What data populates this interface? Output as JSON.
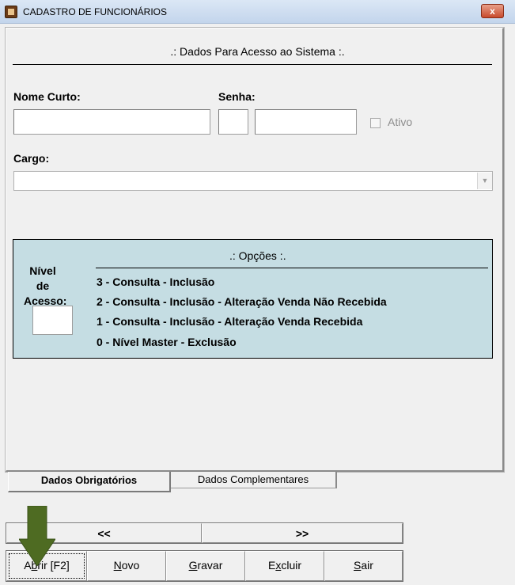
{
  "window": {
    "title": "CADASTRO DE FUNCIONÁRIOS",
    "close_label": "x"
  },
  "section_title": ".: Dados Para Acesso ao Sistema :.",
  "fields": {
    "nome_curto_label": "Nome Curto:",
    "nome_curto_value": "",
    "senha_label": "Senha:",
    "senha_prefix_value": "",
    "senha_value": "",
    "ativo_label": "Ativo",
    "cargo_label": "Cargo:",
    "cargo_value": ""
  },
  "options": {
    "title": ".: Opções :.",
    "nivel_label_line1": "Nível de",
    "nivel_label_line2": "Acesso:",
    "nivel_value": "",
    "items": [
      "3 - Consulta - Inclusão",
      "2 - Consulta - Inclusão - Alteração Venda Não Recebida",
      "1 - Consulta - Inclusão - Alteração Venda Recebida",
      "0 - Nível Master - Exclusão"
    ]
  },
  "tabs": [
    {
      "label": "Dados Obrigatórios",
      "active": true
    },
    {
      "label": "Dados Complementares",
      "active": false
    }
  ],
  "nav": {
    "prev": "<<",
    "next": ">>"
  },
  "buttons": {
    "abrir_pre": "A",
    "abrir_ul": "b",
    "abrir_post": "rir [F2]",
    "novo_ul": "N",
    "novo_post": "ovo",
    "gravar_ul": "G",
    "gravar_post": "ravar",
    "excluir_pre": "E",
    "excluir_ul": "x",
    "excluir_post": "cluir",
    "sair_ul": "S",
    "sair_post": "air"
  },
  "icons": {
    "window_icon": "app-icon",
    "pointer": "down-arrow-icon",
    "dropdown": "chevron-down-icon"
  },
  "colors": {
    "options_bg": "#c5dde3",
    "arrow": "#4e6b22",
    "titlebar": "#c3d5ec"
  }
}
